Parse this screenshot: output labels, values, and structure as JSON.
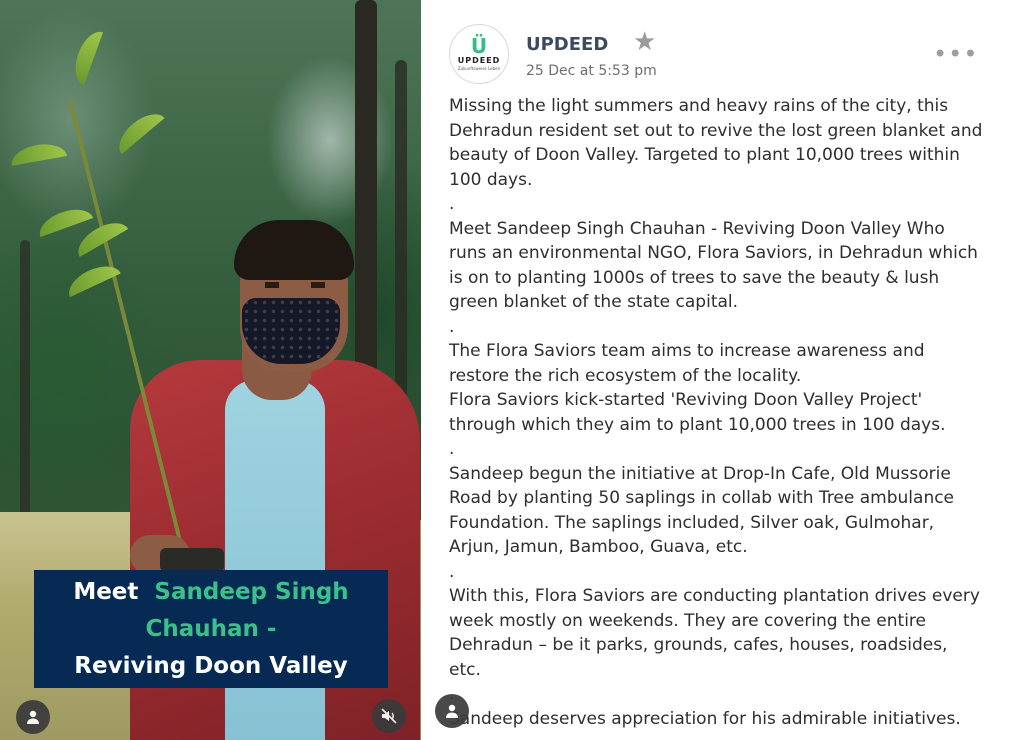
{
  "photo": {
    "caption": {
      "prefix": "Meet",
      "name_line1": "Sandeep Singh",
      "name_line2": "Chauhan -",
      "line3": "Reviving Doon Valley"
    },
    "icons": {
      "profile": "user-icon",
      "mute": "muted-speaker-icon"
    }
  },
  "post": {
    "avatar": {
      "brand_letter": "Ü",
      "brand_word": "UPDEED",
      "tagline": "Zukunftsweise Leben"
    },
    "author": "UPDEED",
    "timestamp": "25 Dec at 5:53 pm",
    "lines": [
      "Missing the light summers and heavy rains of the city, this",
      "Dehradun resident set out to revive the lost green blanket and",
      "beauty of Doon Valley. Targeted to plant 10,000 trees within",
      "100 days.",
      ".",
      "Meet Sandeep Singh Chauhan - Reviving Doon Valley Who",
      "runs an environmental NGO, Flora Saviors, in Dehradun which",
      "is on to planting 1000s of trees to save the beauty & lush",
      "green blanket of the state capital.",
      ".",
      "The Flora Saviors team aims to increase awareness and",
      "restore the rich ecosystem of the locality.",
      "Flora Saviors kick-started 'Reviving Doon Valley Project'",
      "through which they aim to plant 10,000 trees in 100 days.",
      ".",
      "Sandeep begun the initiative at Drop-In Cafe, Old Mussorie",
      "Road by planting 50 saplings in collab with Tree ambulance",
      "Foundation. The saplings included, Silver oak, Gulmohar,",
      "Arjun, Jamun, Bamboo, Guava, etc.",
      ".",
      "With this, Flora Saviors are conducting plantation drives every",
      "week mostly on weekends. They are covering the entire",
      "Dehradun – be it parks, grounds, cafes, houses, roadsides,",
      "etc.",
      ".",
      "Sandeep deserves appreciation for his admirable initiatives."
    ],
    "icons": {
      "favorite": "star-icon",
      "menu": "more-options-icon"
    },
    "accent_color": "#2fbf86",
    "caption_bg_color": "#062a54"
  }
}
